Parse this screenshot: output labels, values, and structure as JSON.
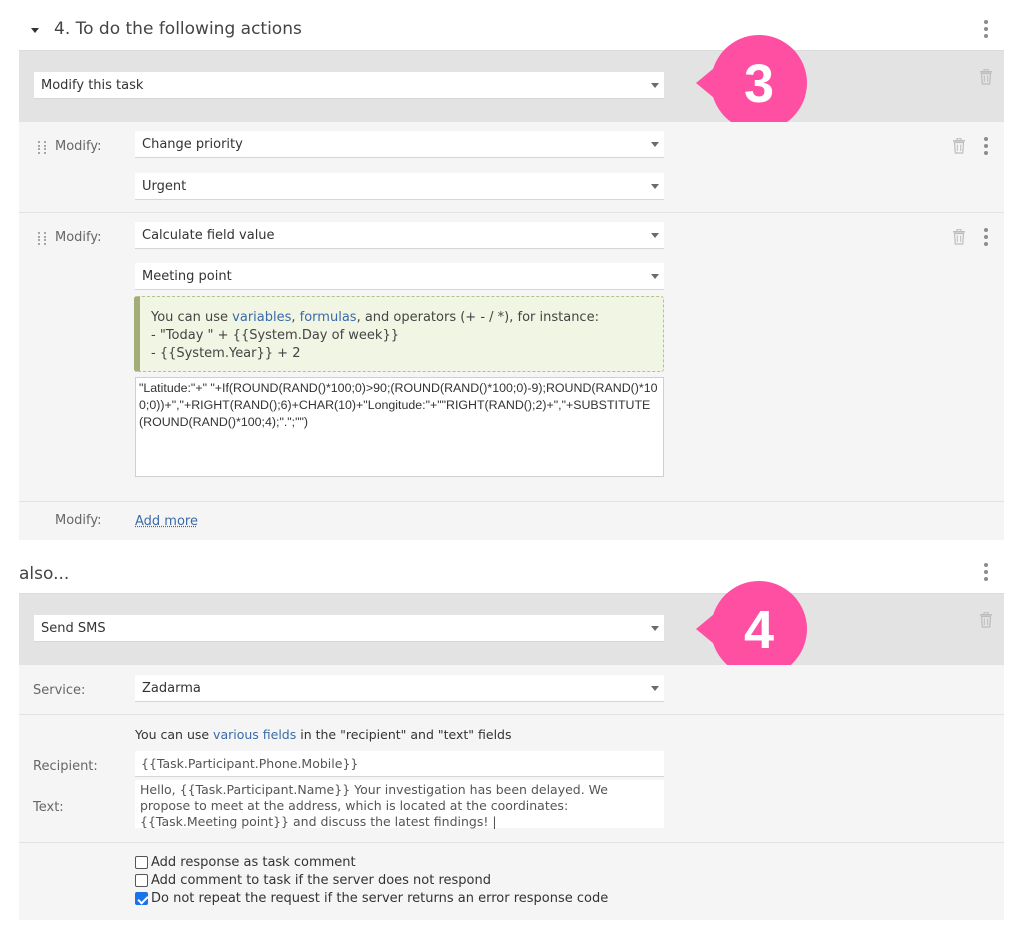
{
  "section4": {
    "title": "4. To do the following actions",
    "action_select": "Modify this task",
    "badge_number": "3",
    "modify_label": "Modify:",
    "modify1": {
      "field": "Change priority",
      "value": "Urgent"
    },
    "modify2": {
      "field": "Calculate field value",
      "target": "Meeting point",
      "hint": {
        "prefix": "You can use ",
        "link1": "variables",
        "comma": ", ",
        "link2": "formulas",
        "suffix": ", and operators (+ - / *), for instance:",
        "example1": "- \"Today \" + {{System.Day of week}}",
        "example2": "- {{System.Year}} + 2"
      },
      "formula": "\"Latitude:\"+\" \"+If(ROUND(RAND()*100;0)>90;(ROUND(RAND()*100;0)-9);ROUND(RAND()*100;0))+\",\"+RIGHT(RAND();6)+CHAR(10)+\"Longitude:\"+\"\"RIGHT(RAND();2)+\",\"+SUBSTITUTE(ROUND(RAND()*100;4);\".\";\"\")"
    },
    "add_more": "Add more"
  },
  "also": {
    "title": "also...",
    "action_select": "Send SMS",
    "badge_number": "4",
    "service_label": "Service:",
    "service_value": "Zadarma",
    "fields_hint_prefix": "You can use ",
    "fields_hint_link": "various fields",
    "fields_hint_suffix": " in the \"recipient\" and \"text\" fields",
    "recipient_label": "Recipient:",
    "recipient_value": "{{Task.Participant.Phone.Mobile}}",
    "text_label": "Text:",
    "text_value": "Hello, {{Task.Participant.Name}} Your investigation has been delayed. We propose to meet at the address, which is located at the coordinates: {{Task.Meeting point}} and discuss the latest findings! |",
    "checkboxes": [
      {
        "label": "Add response as task comment",
        "checked": false
      },
      {
        "label": "Add comment to task if the server does not respond",
        "checked": false
      },
      {
        "label": "Do not repeat the request if the server returns an error response code",
        "checked": true
      }
    ]
  },
  "colors": {
    "badge": "#ff4fa3",
    "link": "#3a6aa8",
    "panel": "#f5f5f5",
    "band": "#e3e3e3"
  }
}
